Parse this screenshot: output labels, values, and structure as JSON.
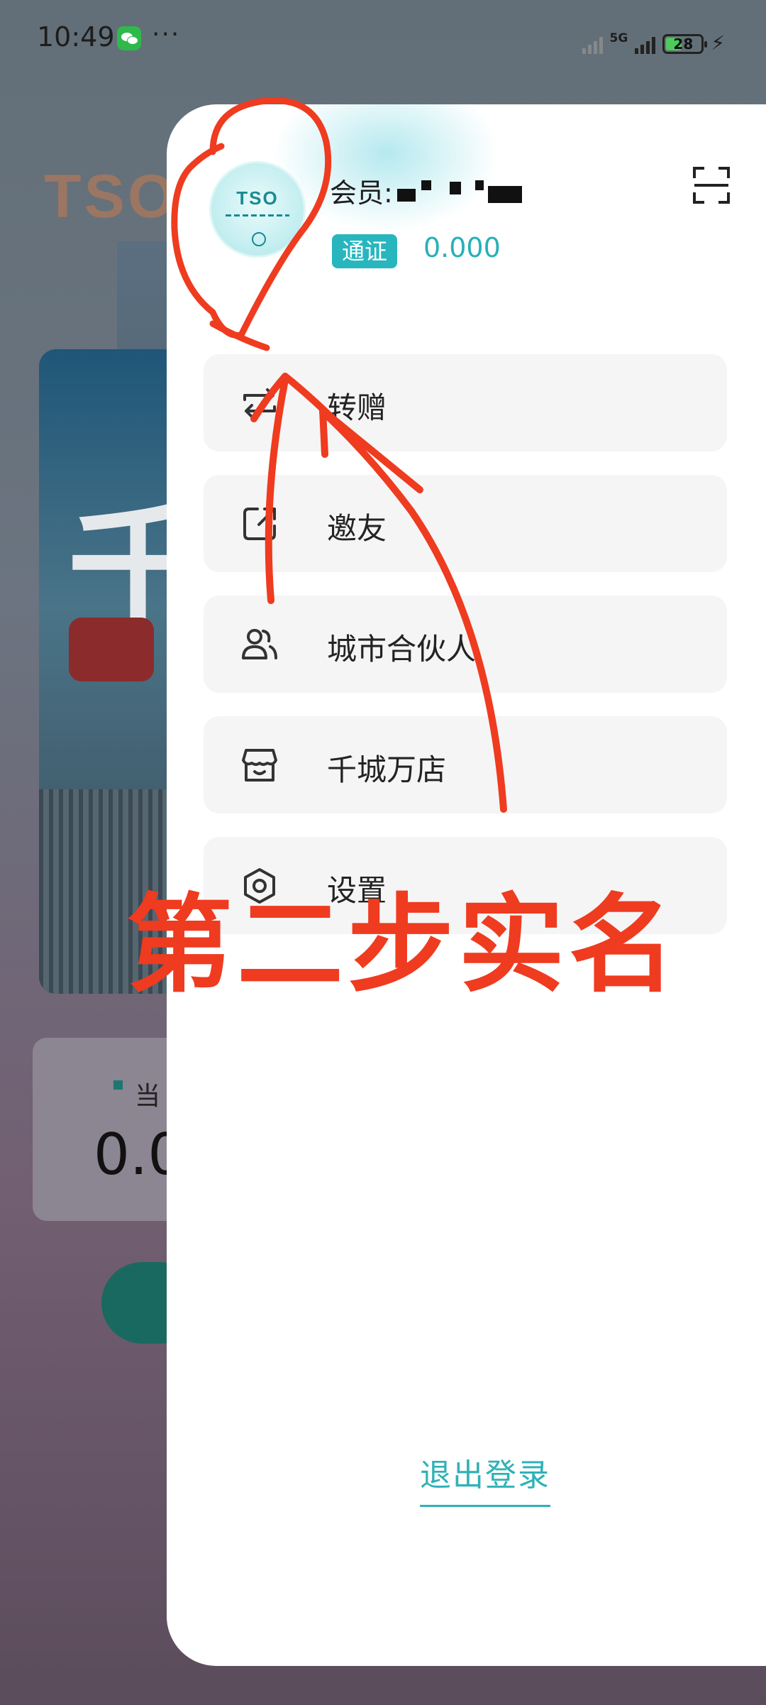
{
  "status_bar": {
    "time": "10:49",
    "dots": "···",
    "network": "5G",
    "battery": "28",
    "icons": [
      "wechat-icon",
      "signal-icon",
      "battery-icon",
      "charging-icon"
    ]
  },
  "background": {
    "logo": "TSO",
    "banner_char": "千",
    "card_label": "当",
    "card_value": "0.0"
  },
  "drawer": {
    "member_label": "会员:",
    "token_tag": "通证",
    "token_value": "0.000",
    "avatar_logo": "TSO",
    "menu": [
      {
        "label": "转赠",
        "icon": "transfer-icon"
      },
      {
        "label": "邀友",
        "icon": "share-icon"
      },
      {
        "label": "城市合伙人",
        "icon": "users-icon"
      },
      {
        "label": "千城万店",
        "icon": "store-icon"
      },
      {
        "label": "设置",
        "icon": "settings-icon"
      }
    ],
    "logout": "退出登录"
  },
  "annotation": {
    "text": "第二步实名",
    "color": "#ef3b1f"
  },
  "colors": {
    "accent": "#27b6be",
    "annotation_red": "#ef3b1f"
  }
}
